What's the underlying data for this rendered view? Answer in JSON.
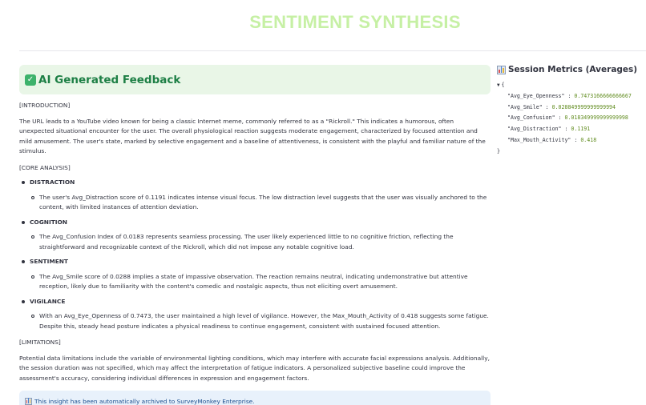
{
  "app": {
    "title": "SENTIMENT SYNTHESIS"
  },
  "feedback": {
    "heading": "AI Generated Feedback",
    "intro_label": "[INTRODUCTION]",
    "intro_text": "The URL leads to a YouTube video known for being a classic Internet meme, commonly referred to as a \"Rickroll.\" This indicates a humorous, often unexpected situational encounter for the user. The overall physiological reaction suggests moderate engagement, characterized by focused attention and mild amusement. The user's state, marked by selective engagement and a baseline of attentiveness, is consistent with the playful and familiar nature of the stimulus.",
    "core_label": "[CORE ANALYSIS]",
    "items": [
      {
        "title": "DISTRACTION",
        "detail": "The user's Avg_Distraction score of 0.1191 indicates intense visual focus. The low distraction level suggests that the user was visually anchored to the content, with limited instances of attention deviation."
      },
      {
        "title": "COGNITION",
        "detail": "The Avg_Confusion Index of 0.0183 represents seamless processing. The user likely experienced little to no cognitive friction, reflecting the straightforward and recognizable context of the Rickroll, which did not impose any notable cognitive load."
      },
      {
        "title": "SENTIMENT",
        "detail": "The Avg_Smile score of 0.0288 implies a state of impassive observation. The reaction remains neutral, indicating undemonstrative but attentive reception, likely due to familiarity with the content's comedic and nostalgic aspects, thus not eliciting overt amusement."
      },
      {
        "title": "VIGILANCE",
        "detail": "With an Avg_Eye_Openness of 0.7473, the user maintained a high level of vigilance. However, the Max_Mouth_Activity of 0.418 suggests some fatigue. Despite this, steady head posture indicates a physical readiness to continue engagement, consistent with sustained focused attention."
      }
    ],
    "limitations_label": "[LIMITATIONS]",
    "limitations_text": "Potential data limitations include the variable of environmental lighting conditions, which may interfere with accurate facial expressions analysis. Additionally, the session duration was not specified, which may affect the interpretation of fatigue indicators. A personalized subjective baseline could improve the assessment's accuracy, considering individual differences in expression and engagement factors.",
    "archive_notice": "This insight has been automatically archived to SurveyMonkey Enterprise."
  },
  "metrics": {
    "heading": "Session Metrics (Averages)",
    "open_brace": "{",
    "close_brace": "}",
    "entries": [
      {
        "key": "\"Avg_Eye_Openness\"",
        "value": "0.7473166666666667"
      },
      {
        "key": "\"Avg_Smile\"",
        "value": "0.028849999999999994"
      },
      {
        "key": "\"Avg_Confusion\"",
        "value": "0.018349999999999998"
      },
      {
        "key": "\"Avg_Distraction\"",
        "value": "0.1191"
      },
      {
        "key": "\"Max_Mouth_Activity\"",
        "value": "0.418"
      }
    ]
  },
  "colors": {
    "title": "#c6f0a4",
    "success_bg": "#e9f6e7",
    "success_text": "#1d7f45",
    "info_bg": "#e8f1fb",
    "info_text": "#1c4f8f",
    "json_number": "#5f8b1d"
  },
  "icons": {
    "header_icon": "check-mark-icon",
    "metrics_icon": "bar-chart-icon",
    "archive_icon": "bar-chart-icon",
    "json_toggle": "caret-down-icon"
  }
}
